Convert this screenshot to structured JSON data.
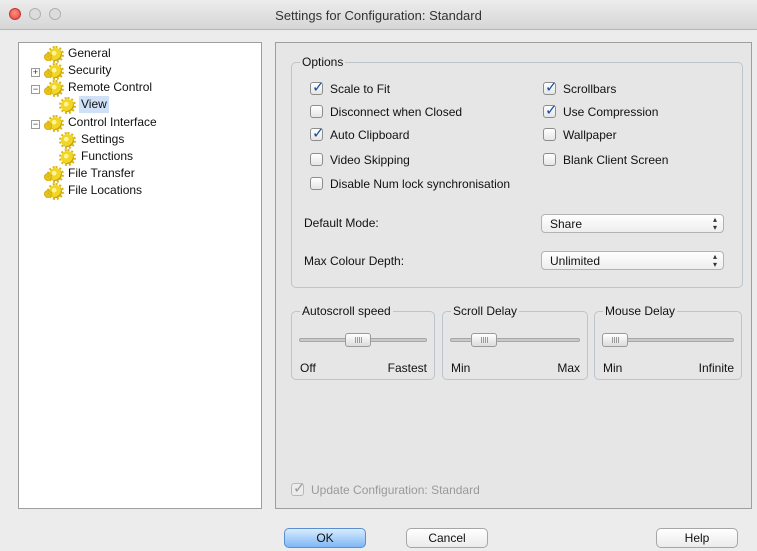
{
  "window": {
    "title": "Settings for Configuration: Standard"
  },
  "tree": {
    "items": [
      {
        "label": "General"
      },
      {
        "label": "Security",
        "expander": "+"
      },
      {
        "label": "Remote Control",
        "expander": "−"
      },
      {
        "label": "View",
        "selected": true
      },
      {
        "label": "Control Interface",
        "expander": "−"
      },
      {
        "label": "Settings"
      },
      {
        "label": "Functions"
      },
      {
        "label": "File Transfer"
      },
      {
        "label": "File Locations"
      }
    ]
  },
  "options": {
    "group_title": "Options",
    "checkboxes": [
      {
        "label": "Scale to Fit",
        "checked": true
      },
      {
        "label": "Scrollbars",
        "checked": true
      },
      {
        "label": "Disconnect when Closed",
        "checked": false
      },
      {
        "label": "Use Compression",
        "checked": true
      },
      {
        "label": "Auto Clipboard",
        "checked": true
      },
      {
        "label": "Wallpaper",
        "checked": false
      },
      {
        "label": "Video Skipping",
        "checked": false
      },
      {
        "label": "Blank Client Screen",
        "checked": false
      },
      {
        "label": "Disable Num lock synchronisation",
        "checked": false
      }
    ],
    "default_mode": {
      "label": "Default Mode:",
      "value": "Share"
    },
    "max_colour_depth": {
      "label": "Max Colour Depth:",
      "value": "Unlimited"
    }
  },
  "sliders": {
    "autoscroll": {
      "title": "Autoscroll speed",
      "min_label": "Off",
      "max_label": "Fastest",
      "value": 0.45
    },
    "scroll_delay": {
      "title": "Scroll Delay",
      "min_label": "Min",
      "max_label": "Max",
      "value": 0.2
    },
    "mouse_delay": {
      "title": "Mouse Delay",
      "min_label": "Min",
      "max_label": "Infinite",
      "value": 0.0
    }
  },
  "update_config": {
    "label": "Update Configuration: Standard",
    "checked": true,
    "disabled": true
  },
  "buttons": {
    "ok": "OK",
    "cancel": "Cancel",
    "help": "Help"
  },
  "icons": {
    "tree_node": "gear-icon",
    "selected_highlight": "#cfe0f7"
  }
}
